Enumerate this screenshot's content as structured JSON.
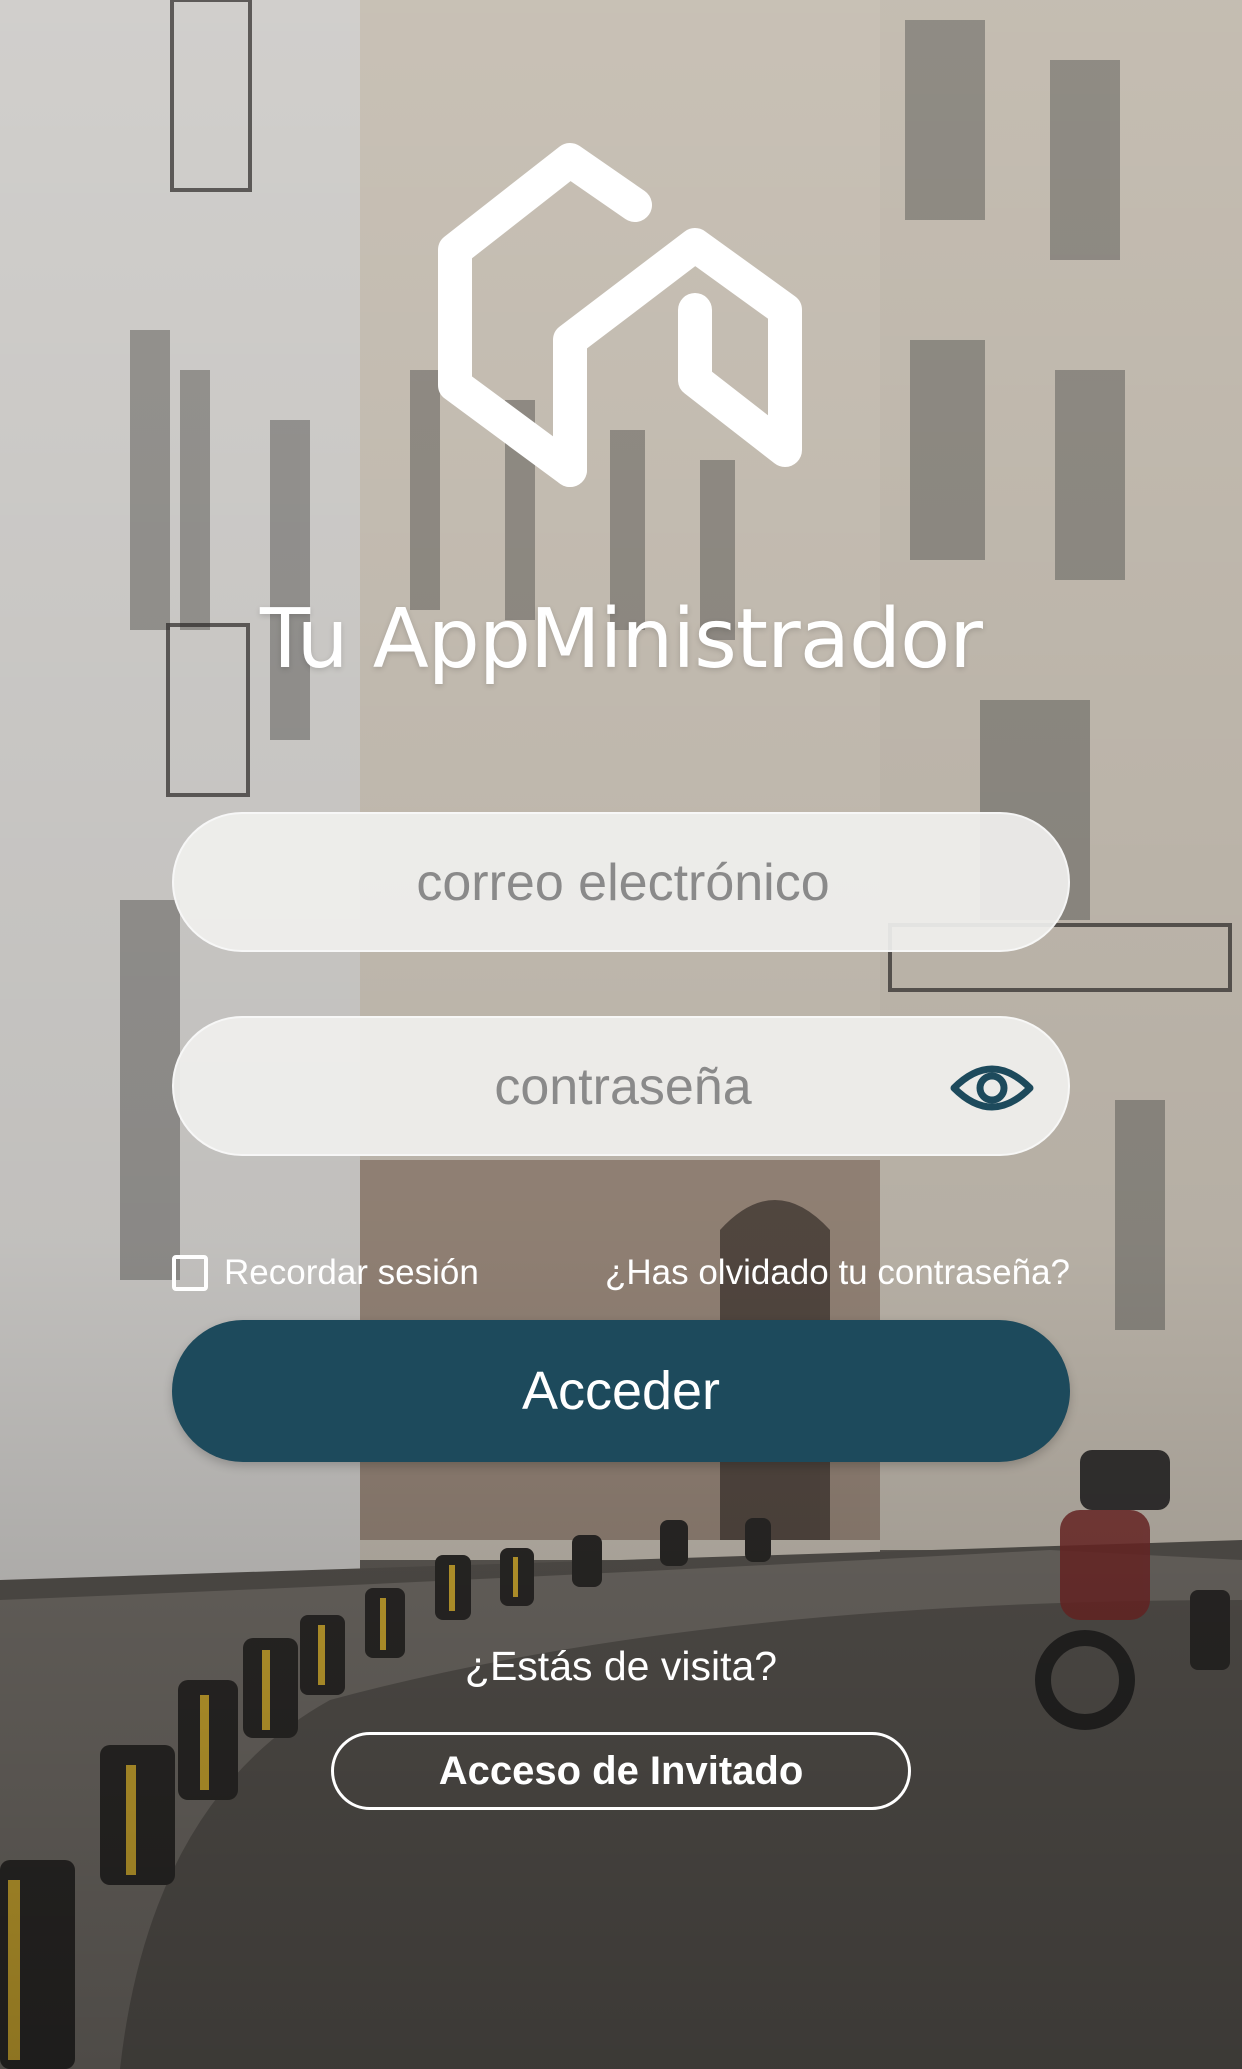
{
  "app": {
    "title": "Tu AppMinistrador"
  },
  "form": {
    "email_placeholder": "correo electrónico",
    "email_value": "",
    "password_placeholder": "contraseña",
    "password_value": "",
    "remember_label": "Recordar sesión",
    "remember_checked": false,
    "forgot_label": "¿Has olvidado tu contraseña?",
    "login_label": "Acceder"
  },
  "guest": {
    "prompt": "¿Estás de visita?",
    "button_label": "Acceso de Invitado"
  },
  "colors": {
    "primary": "#1d4a5c",
    "text_light": "#ffffff",
    "field_bg": "#efefed"
  },
  "icons": {
    "logo": "house-logo-icon",
    "toggle_password": "eye-icon"
  }
}
